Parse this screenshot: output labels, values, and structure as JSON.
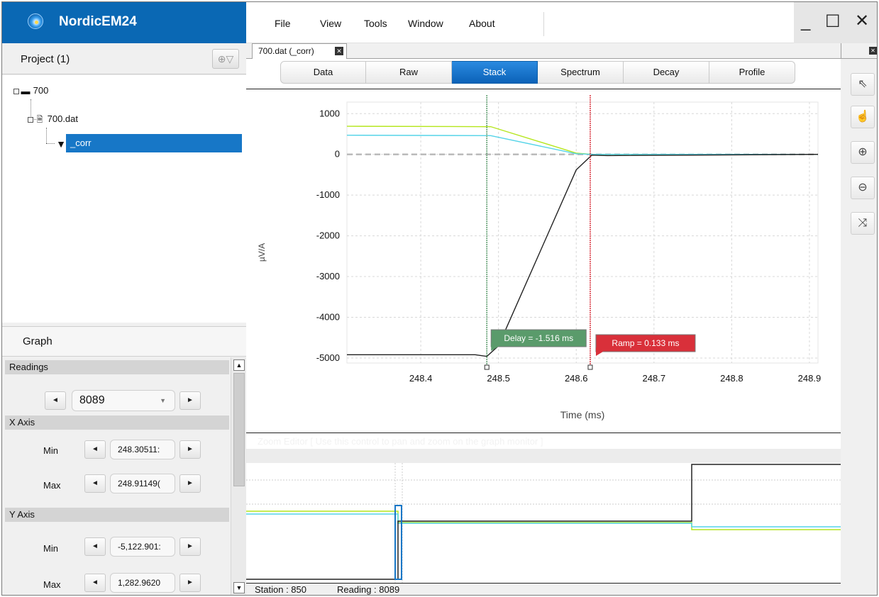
{
  "app": {
    "name": "NordicEM24"
  },
  "menu": {
    "items": [
      "File",
      "View",
      "Tools",
      "Window",
      "About"
    ]
  },
  "window_controls": {
    "minimize": "_",
    "maximize": "☐",
    "close": "✕"
  },
  "project": {
    "title": "Project (1)",
    "tree": {
      "root": "700",
      "file": "700.dat",
      "filter": "_corr"
    }
  },
  "document_tab": {
    "label": "700.dat (_corr)",
    "close": "✕"
  },
  "view_tabs": [
    "Data",
    "Raw",
    "Stack",
    "Spectrum",
    "Decay",
    "Profile"
  ],
  "active_view_tab": "Stack",
  "graph_panel": {
    "title": "Graph",
    "readings": {
      "heading": "Readings",
      "value": "8089"
    },
    "x_axis": {
      "heading": "X Axis",
      "min_label": "Min",
      "min_value": "248.30511:",
      "max_label": "Max",
      "max_value": "248.91149("
    },
    "y_axis": {
      "heading": "Y Axis",
      "min_label": "Min",
      "min_value": "-5,122.901:",
      "max_label": "Max",
      "max_value": "1,282.9620"
    },
    "prev_icon": "◄",
    "next_icon": "►"
  },
  "chart_data": {
    "type": "line",
    "xlabel": "Time (ms)",
    "ylabel": "µV/A",
    "xlim": [
      248.305,
      248.911
    ],
    "ylim": [
      -5122.9,
      1282.96
    ],
    "x_ticks": [
      "248.4",
      "248.5",
      "248.6",
      "248.7",
      "248.8",
      "248.9"
    ],
    "y_ticks": [
      "1000",
      "0",
      "-1000",
      "-2000",
      "-3000",
      "-4000",
      "-5000"
    ],
    "grid": true,
    "series": [
      {
        "color": "#b5e61d",
        "x": [
          248.305,
          248.49,
          248.6,
          248.62,
          248.911
        ],
        "y": [
          690,
          680,
          30,
          0,
          0
        ]
      },
      {
        "color": "#55d4e8",
        "x": [
          248.305,
          248.49,
          248.6,
          248.62,
          248.911
        ],
        "y": [
          470,
          460,
          15,
          0,
          0
        ]
      },
      {
        "color": "#222222",
        "x": [
          248.305,
          248.47,
          248.485,
          248.5,
          248.6,
          248.62,
          248.64,
          248.911
        ],
        "y": [
          -4920,
          -4920,
          -4960,
          -4700,
          -380,
          -20,
          -30,
          0
        ]
      }
    ],
    "reference_line": {
      "y": 0,
      "color": "#bbbbbb"
    },
    "markers": [
      {
        "x": 248.485,
        "label": "Delay = -1.516 ms",
        "color": "#5a9b6b"
      },
      {
        "x": 248.618,
        "label": "Ramp = 0.133 ms",
        "color": "#d9303a"
      }
    ]
  },
  "zoom_editor": {
    "caption": "Zoom Editor [ Use this control to pan and zoom on the graph monitor ]"
  },
  "status": {
    "station": "Station : 850",
    "reading": "Reading : 8089"
  },
  "tools": [
    "pointer-icon",
    "hand-icon",
    "zoom-in-icon",
    "zoom-out-icon",
    "fit-icon"
  ]
}
